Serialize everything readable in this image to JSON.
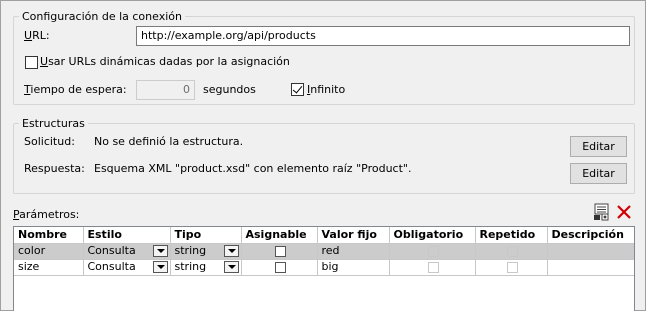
{
  "connection": {
    "title": "Configuración de la conexión",
    "url_label_first": "U",
    "url_label_rest": "RL:",
    "url_value": "http://example.org/api/products",
    "dynamic_urls_first": "U",
    "dynamic_urls_rest": "sar URLs dinámicas dadas por la asignación",
    "dynamic_urls_checked": false,
    "timeout_label_first": "T",
    "timeout_label_rest": "iempo de espera:",
    "timeout_value": "0",
    "timeout_unit": "segundos",
    "infinite_first": "I",
    "infinite_rest": "nfinito",
    "infinite_checked": true
  },
  "structures": {
    "title": "Estructuras",
    "request_label": "Solicitud:",
    "request_value": "No se definió la estructura.",
    "request_edit": "Editar",
    "response_label": "Respuesta:",
    "response_value": "Esquema XML \"product.xsd\" con elemento raíz \"Product\".",
    "response_edit": "Editar"
  },
  "parameters": {
    "label_first": "P",
    "label_rest": "arámetros:",
    "add_icon": "add-parameter-icon",
    "delete_icon": "delete-icon",
    "delete_color": "#d40000",
    "columns": [
      "Nombre",
      "Estilo",
      "Tipo",
      "Asignable",
      "Valor fijo",
      "Obligatorio",
      "Repetido",
      "Descripción"
    ],
    "rows": [
      {
        "name": "color",
        "style": "Consulta",
        "type": "string",
        "assignable": false,
        "fixed_value": "red",
        "required": false,
        "repeated": false,
        "description": ""
      },
      {
        "name": "size",
        "style": "Consulta",
        "type": "string",
        "assignable": false,
        "fixed_value": "big",
        "required": false,
        "repeated": false,
        "description": ""
      }
    ]
  }
}
